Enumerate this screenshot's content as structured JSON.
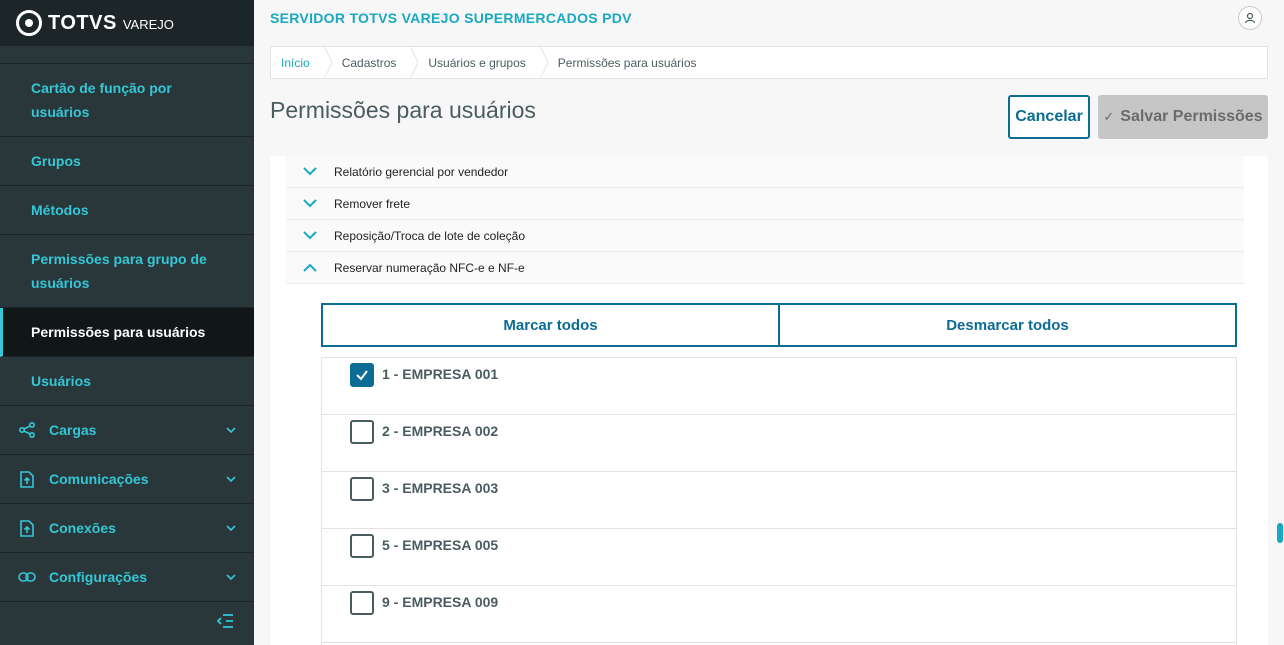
{
  "brand": {
    "name": "TOTVS",
    "sub": "VAREJO"
  },
  "header": {
    "app_title": "SERVIDOR TOTVS VAREJO SUPERMERCADOS PDV"
  },
  "sidebar": {
    "items": [
      {
        "label": "Cartão de função por usuários"
      },
      {
        "label": "Grupos"
      },
      {
        "label": "Métodos"
      },
      {
        "label": "Permissões para grupo de usuários"
      },
      {
        "label": "Permissões para usuários"
      },
      {
        "label": "Usuários"
      }
    ],
    "groups": [
      {
        "label": "Cargas",
        "icon": "share-icon"
      },
      {
        "label": "Comunicações",
        "icon": "file-upload-icon"
      },
      {
        "label": "Conexões",
        "icon": "file-upload-icon"
      },
      {
        "label": "Configurações",
        "icon": "link-icon"
      }
    ]
  },
  "breadcrumb": [
    "Início",
    "Cadastros",
    "Usuários e grupos",
    "Permissões para usuários"
  ],
  "page": {
    "title": "Permissões para usuários"
  },
  "actions": {
    "cancel": "Cancelar",
    "save": "Salvar Permissões"
  },
  "permissions": [
    {
      "label": "Relatório gerencial por vendedor",
      "expanded": false
    },
    {
      "label": "Remover frete",
      "expanded": false
    },
    {
      "label": "Reposição/Troca de lote de coleção",
      "expanded": false
    },
    {
      "label": "Reservar numeração NFC-e e NF-e",
      "expanded": true
    }
  ],
  "toggle": {
    "mark_all": "Marcar todos",
    "unmark_all": "Desmarcar todos"
  },
  "companies": [
    {
      "name": "1 - EMPRESA 001",
      "checked": true
    },
    {
      "name": "2 - EMPRESA 002",
      "checked": false
    },
    {
      "name": "3 - EMPRESA 003",
      "checked": false
    },
    {
      "name": "5 - EMPRESA 005",
      "checked": false
    },
    {
      "name": "9 - EMPRESA 009",
      "checked": false
    }
  ],
  "colors": {
    "accent": "#18a9c2",
    "primary": "#0c6c94",
    "sidebar": "#29373b"
  }
}
